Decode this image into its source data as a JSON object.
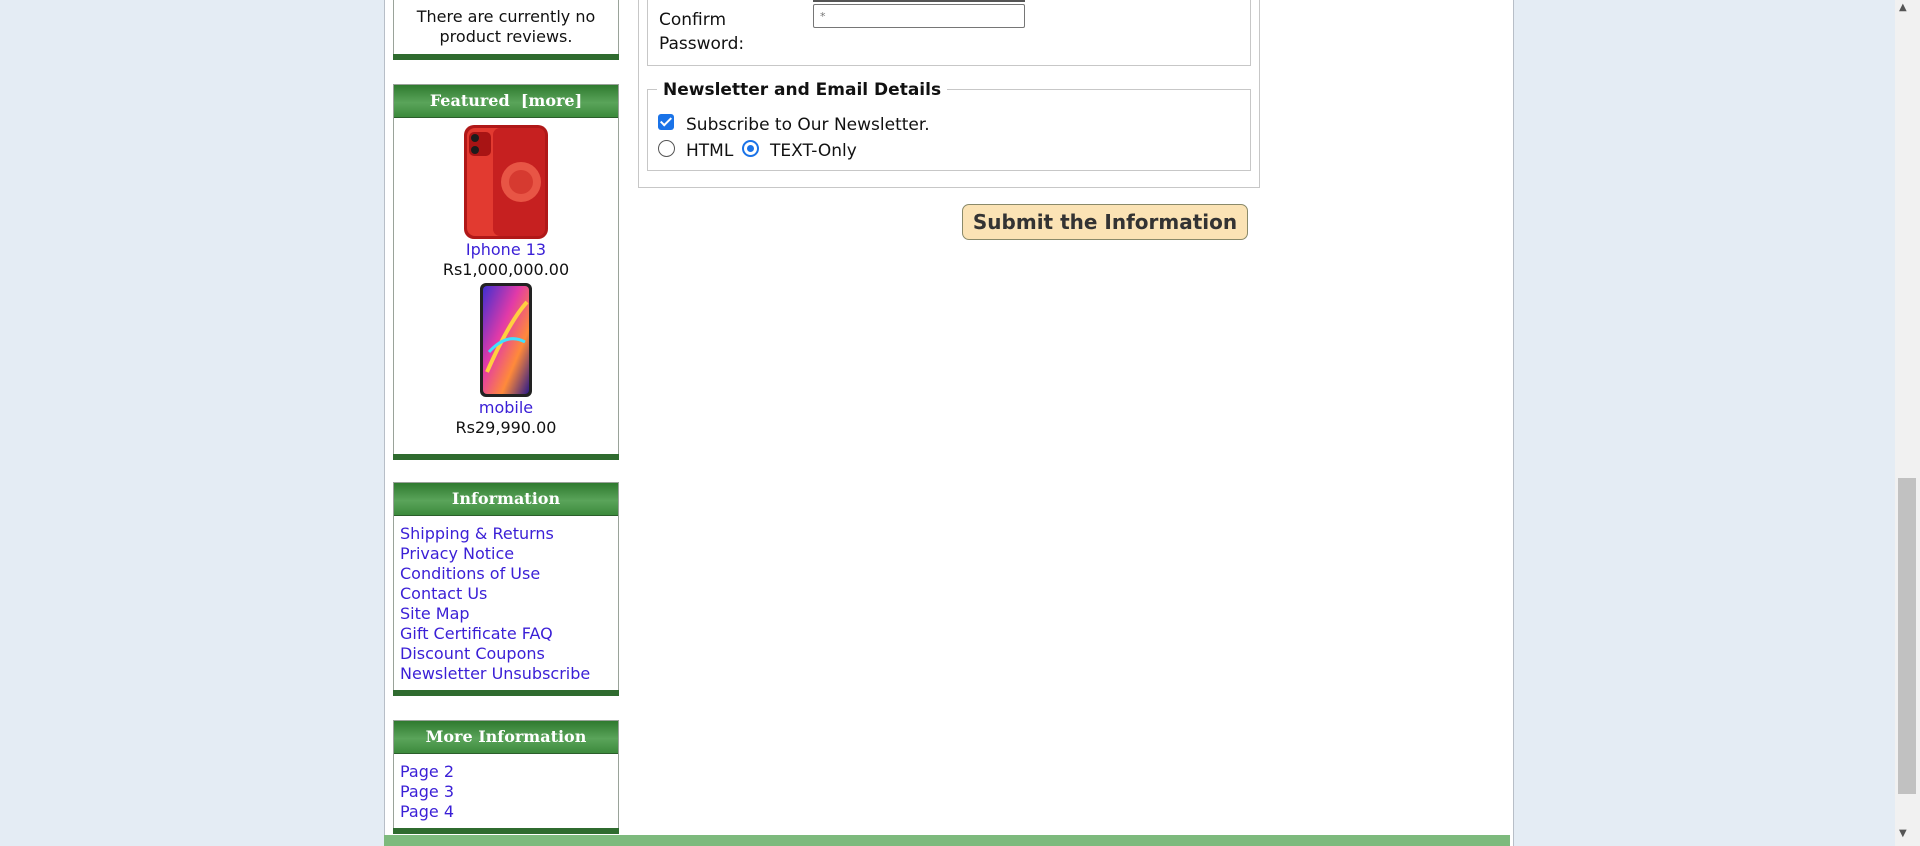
{
  "sidebar": {
    "reviews": {
      "body": "There are currently no product reviews."
    },
    "featured": {
      "title": "Featured",
      "more": "[more]",
      "products": [
        {
          "name": "Iphone 13",
          "price": "Rs1,000,000.00",
          "image": "red-phone-image"
        },
        {
          "name": "mobile",
          "price": "Rs29,990.00",
          "image": "colorful-phone-image"
        }
      ]
    },
    "information": {
      "title": "Information",
      "links": [
        "Shipping & Returns",
        "Privacy Notice",
        "Conditions of Use",
        "Contact Us",
        "Site Map",
        "Gift Certificate FAQ",
        "Discount Coupons",
        "Newsletter Unsubscribe"
      ]
    },
    "more_information": {
      "title": "More Information",
      "links": [
        "Page 2",
        "Page 3",
        "Page 4"
      ]
    }
  },
  "form": {
    "confirm_password_label": "Confirm Password:",
    "confirm_password_placeholder": "*",
    "newsletter_legend": "Newsletter and Email Details",
    "subscribe_label": "Subscribe to Our Newsletter.",
    "subscribe_checked": true,
    "format_options": [
      "HTML",
      "TEXT-Only"
    ],
    "format_selected": "TEXT-Only",
    "submit_label": "Submit the Information"
  },
  "colors": {
    "header_green": "#3c8a3c",
    "link": "#3a1fd6",
    "button_bg": "#fbe3b5",
    "page_bg": "#e4ecf4"
  }
}
